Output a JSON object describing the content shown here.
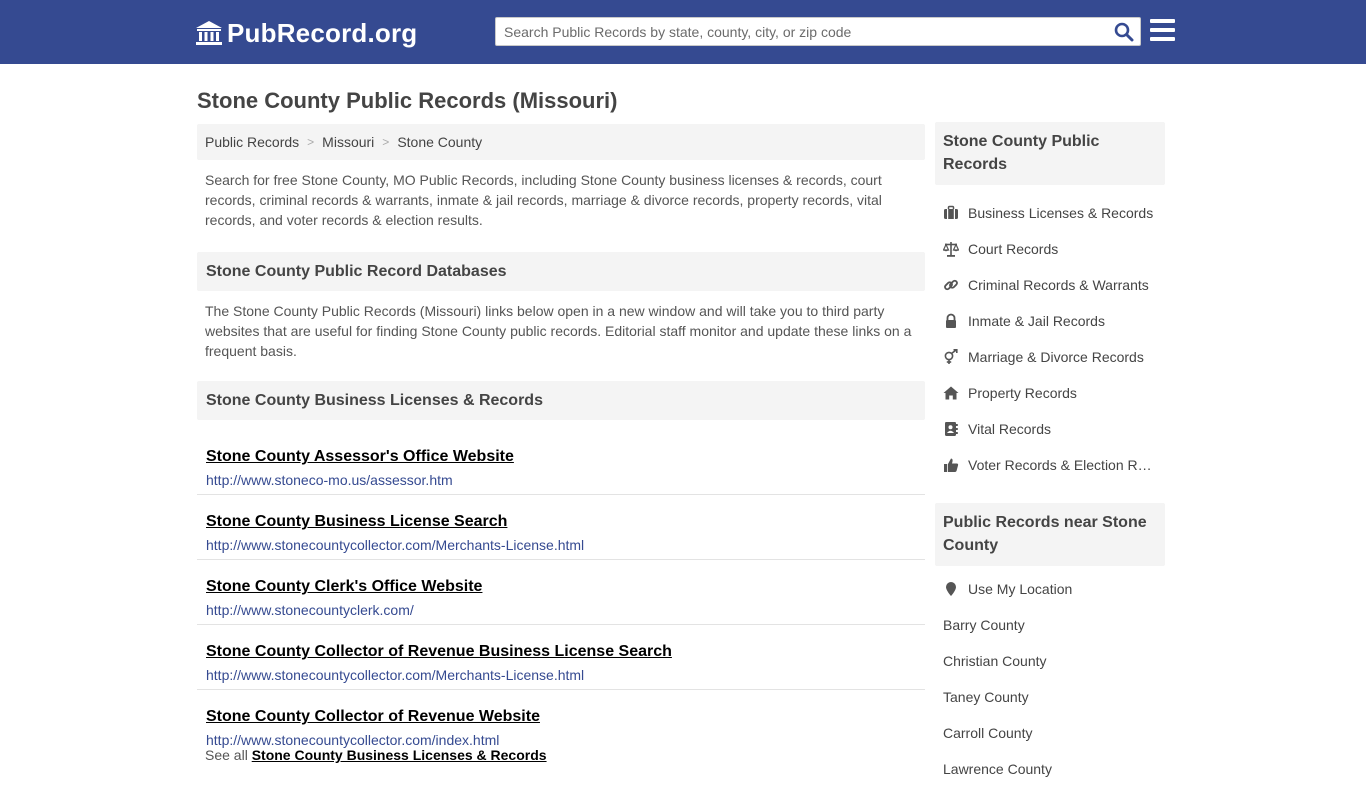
{
  "header": {
    "logo_text": "PubRecord.org",
    "search_placeholder": "Search Public Records by state, county, city, or zip code"
  },
  "page_title": "Stone County Public Records (Missouri)",
  "breadcrumb": [
    "Public Records",
    "Missouri",
    "Stone County"
  ],
  "intro": "Search for free Stone County, MO Public Records, including Stone County business licenses & records, court records, criminal records & warrants, inmate & jail records, marriage & divorce records, property records, vital records, and voter records & election results.",
  "databases": {
    "heading": "Stone County Public Record Databases",
    "description": "The Stone County Public Records (Missouri) links below open in a new window and will take you to third party websites that are useful for finding Stone County public records. Editorial staff monitor and update these links on a frequent basis."
  },
  "business": {
    "heading": "Stone County Business Licenses & Records",
    "links": [
      {
        "title": "Stone County Assessor's Office Website",
        "url": "http://www.stoneco-mo.us/assessor.htm"
      },
      {
        "title": "Stone County Business License Search",
        "url": "http://www.stonecountycollector.com/Merchants-License.html"
      },
      {
        "title": "Stone County Clerk's Office Website",
        "url": "http://www.stonecountyclerk.com/"
      },
      {
        "title": "Stone County Collector of Revenue Business License Search",
        "url": "http://www.stonecountycollector.com/Merchants-License.html"
      },
      {
        "title": "Stone County Collector of Revenue Website",
        "url": "http://www.stonecountycollector.com/index.html"
      }
    ],
    "see_all_prefix": "See all",
    "see_all_link": "Stone County Business Licenses & Records"
  },
  "sidebar": {
    "heading": "Stone County Public Records",
    "items": [
      {
        "label": "Business Licenses & Records",
        "icon": "briefcase-icon"
      },
      {
        "label": "Court Records",
        "icon": "scale-icon"
      },
      {
        "label": "Criminal Records & Warrants",
        "icon": "link-icon"
      },
      {
        "label": "Inmate & Jail Records",
        "icon": "lock-icon"
      },
      {
        "label": "Marriage & Divorce Records",
        "icon": "gender-icon"
      },
      {
        "label": "Property Records",
        "icon": "home-icon"
      },
      {
        "label": "Vital Records",
        "icon": "contact-book-icon"
      },
      {
        "label": "Voter Records & Election Results",
        "icon": "thumbs-up-icon"
      }
    ],
    "near_heading": "Public Records near Stone County",
    "use_location": "Use My Location",
    "near_items": [
      "Barry County",
      "Christian County",
      "Taney County",
      "Carroll County",
      "Lawrence County"
    ]
  }
}
